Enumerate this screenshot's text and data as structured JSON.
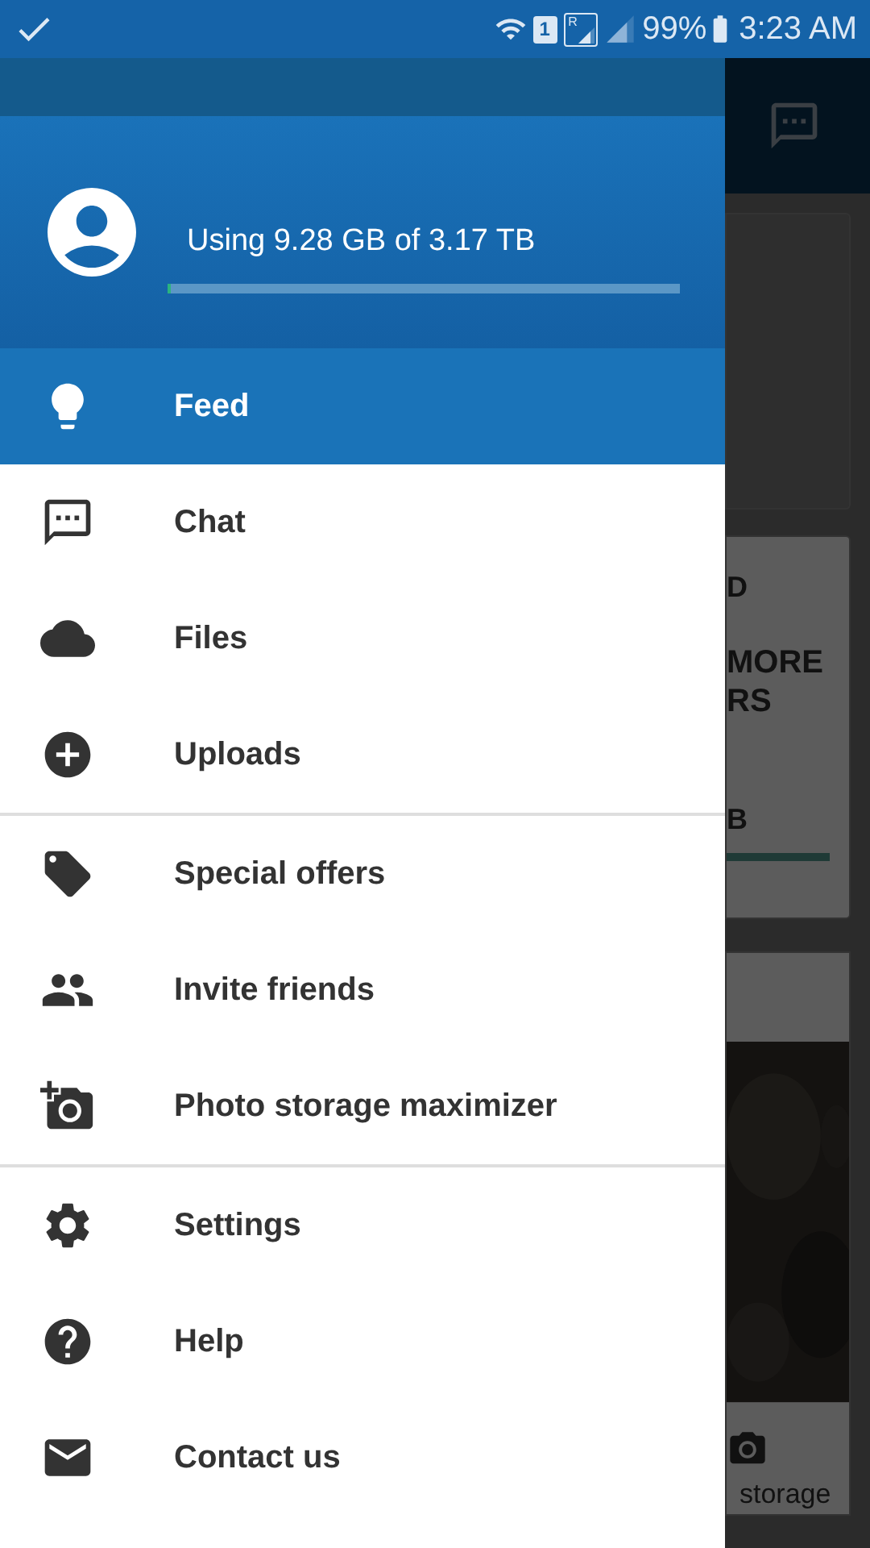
{
  "status_bar": {
    "sim_label": "1",
    "roaming_label": "R",
    "battery": "99%",
    "time": "3:23 AM"
  },
  "drawer": {
    "storage": {
      "text": "Using 9.28 GB of 3.17 TB",
      "level": 0.003
    },
    "sections": [
      [
        {
          "label": "Feed",
          "selected": true
        },
        {
          "label": "Chat",
          "selected": false
        },
        {
          "label": "Files",
          "selected": false
        },
        {
          "label": "Uploads",
          "selected": false
        }
      ],
      [
        {
          "label": "Special offers",
          "selected": false
        },
        {
          "label": "Invite friends",
          "selected": false
        },
        {
          "label": "Photo storage maximizer",
          "selected": false
        }
      ],
      [
        {
          "label": "Settings",
          "selected": false
        },
        {
          "label": "Help",
          "selected": false
        },
        {
          "label": "Contact us",
          "selected": false
        }
      ]
    ]
  },
  "background": {
    "card_texts": [
      "D",
      "MORE",
      "RS",
      "B"
    ],
    "camera_caption": "storage"
  }
}
